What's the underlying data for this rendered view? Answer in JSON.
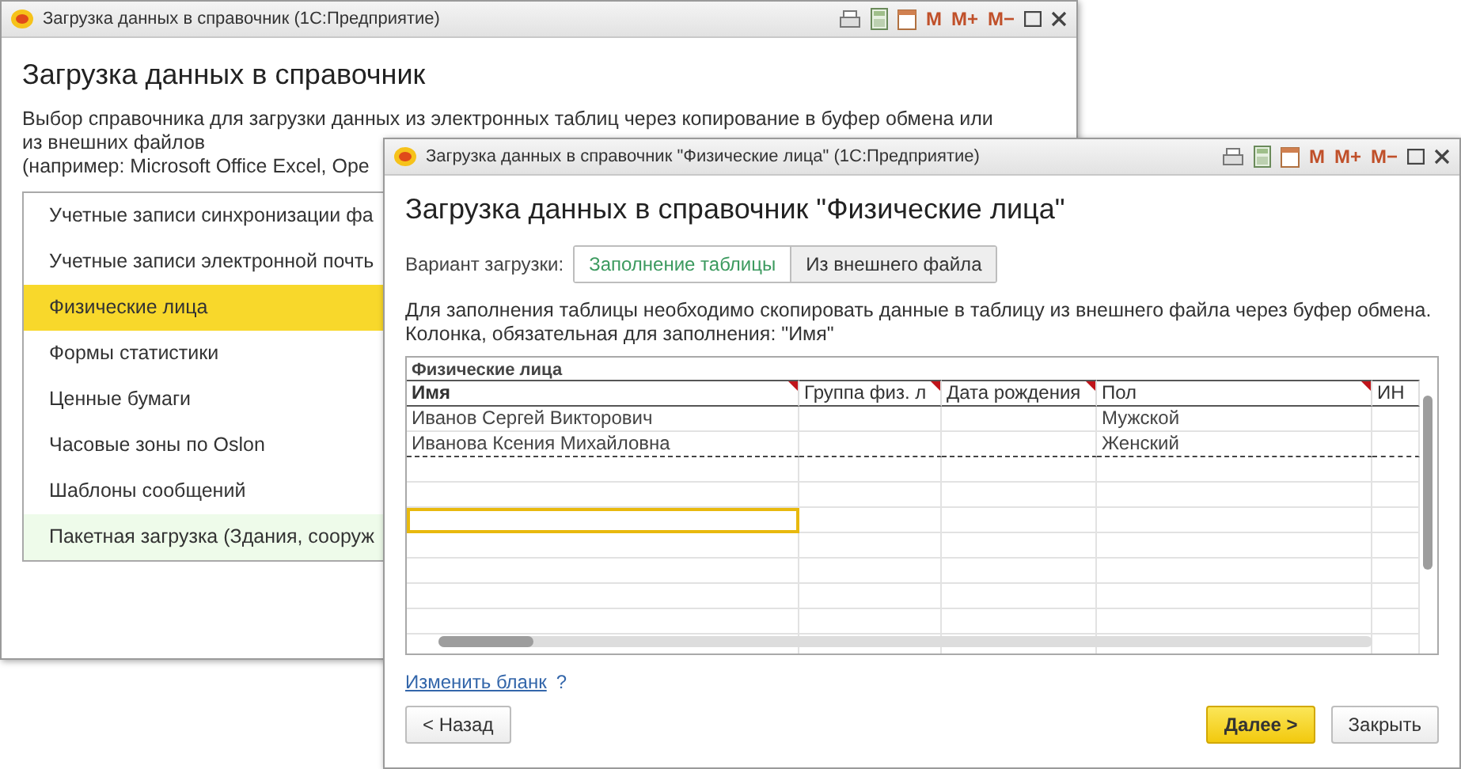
{
  "back_window": {
    "title": "Загрузка данных в справочник  (1С:Предприятие)",
    "toolbar": [
      "M",
      "M+",
      "M−"
    ],
    "heading": "Загрузка данных в справочник",
    "description": [
      "Выбор справочника для загрузки данных из электронных таблиц через копирование в буфер обмена или",
      "из внешних файлов",
      "(например: Microsoft Office Excel, Ope"
    ],
    "catalogs": [
      {
        "label": "Учетные записи синхронизации фа",
        "selected": false,
        "hovered": false
      },
      {
        "label": "Учетные записи электронной почть",
        "selected": false,
        "hovered": false
      },
      {
        "label": "Физические лица",
        "selected": true,
        "hovered": false
      },
      {
        "label": "Формы статистики",
        "selected": false,
        "hovered": false
      },
      {
        "label": "Ценные бумаги",
        "selected": false,
        "hovered": false
      },
      {
        "label": "Часовые зоны по Oslon",
        "selected": false,
        "hovered": false
      },
      {
        "label": "Шаблоны сообщений",
        "selected": false,
        "hovered": false
      },
      {
        "label": "Пакетная загрузка (Здания, сооруж",
        "selected": false,
        "hovered": true
      }
    ]
  },
  "front_window": {
    "title": "Загрузка данных в справочник \"Физические лица\"  (1С:Предприятие)",
    "toolbar": [
      "M",
      "M+",
      "M−"
    ],
    "heading": "Загрузка данных в справочник \"Физические лица\"",
    "variant_label": "Вариант загрузки:",
    "variants": [
      {
        "label": "Заполнение таблицы",
        "selected": true
      },
      {
        "label": "Из внешнего файла",
        "selected": false
      }
    ],
    "description": [
      "Для заполнения таблицы необходимо скопировать данные в таблицу из внешнего файла через буфер обмена.",
      "Колонка, обязательная для заполнения: \"Имя\""
    ],
    "table": {
      "caption": "Физические лица",
      "columns": [
        {
          "label": "Имя",
          "required": true
        },
        {
          "label": "Группа физ. л",
          "required": true
        },
        {
          "label": "Дата рождения",
          "required": true
        },
        {
          "label": "Пол",
          "required": true
        },
        {
          "label": "ИН",
          "required": false
        }
      ],
      "rows": [
        [
          "Иванов Сергей Викторович",
          "",
          "",
          "Мужской",
          ""
        ],
        [
          "Иванова Ксения Михайловна",
          "",
          "",
          "Женский",
          ""
        ]
      ],
      "input_cell": {
        "active": true
      }
    },
    "link": "Изменить бланк",
    "help": "?",
    "buttons": [
      {
        "label": "< Назад",
        "kind": "secondary"
      },
      {
        "label": "Далее >",
        "kind": "primary"
      },
      {
        "label": "Закрыть",
        "kind": "secondary"
      }
    ]
  }
}
